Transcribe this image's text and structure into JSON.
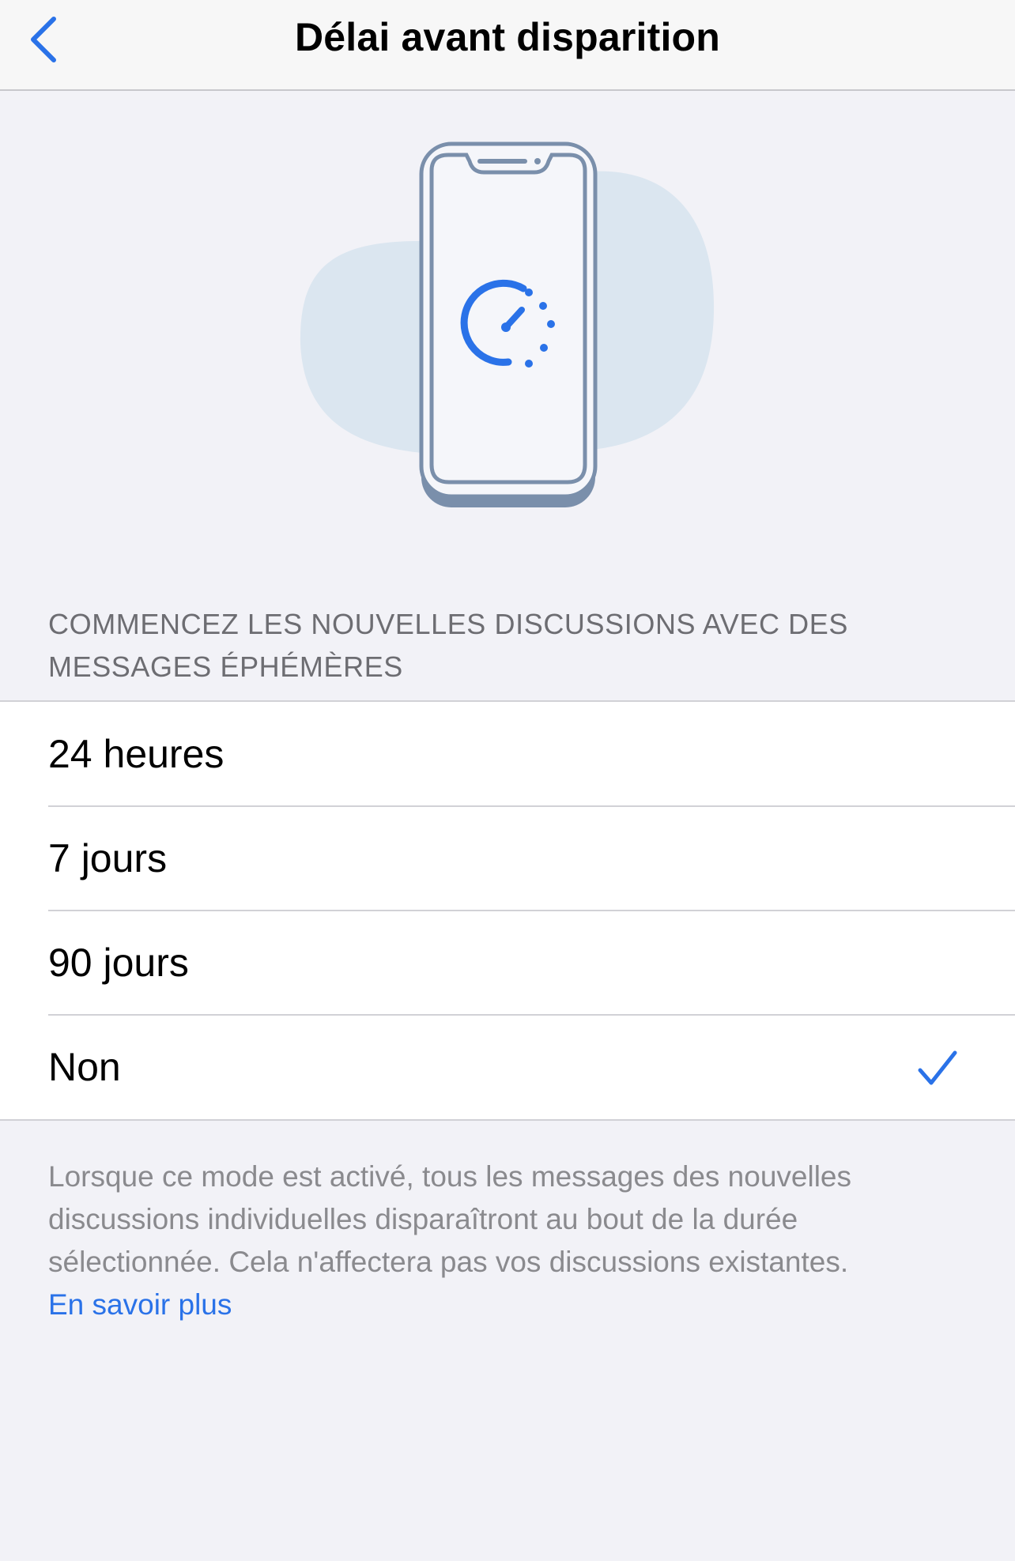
{
  "navbar": {
    "title": "Délai avant disparition",
    "back_icon": "chevron-left-icon"
  },
  "hero": {
    "illustration_icon": "phone-timer-icon"
  },
  "section": {
    "header": "COMMENCEZ LES NOUVELLES DISCUSSIONS AVEC DES MESSAGES ÉPHÉMÈRES"
  },
  "options": [
    {
      "label": "24 heures",
      "selected": false
    },
    {
      "label": "7 jours",
      "selected": false
    },
    {
      "label": "90 jours",
      "selected": false
    },
    {
      "label": "Non",
      "selected": true
    }
  ],
  "footer": {
    "description": "Lorsque ce mode est activé, tous les messages des nouvelles discussions individuelles disparaîtront au bout de la durée sélectionnée. Cela n'affectera pas vos discussions existantes.",
    "link": "En savoir plus"
  },
  "colors": {
    "accent": "#2a72e8",
    "background": "#f2f2f7",
    "phone_outline": "#7a8fab",
    "blob": "#dbe6f0"
  }
}
